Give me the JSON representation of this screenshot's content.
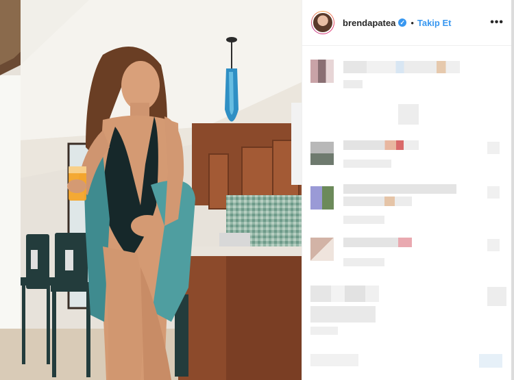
{
  "post": {
    "username": "brendapatea",
    "verified_badge": "✓",
    "separator": "•",
    "follow_label": "Takip Et",
    "more_icon": "more-horizontal-icon"
  },
  "colors": {
    "follow_blue": "#3897f0",
    "username": "#262626",
    "border": "#efefef"
  }
}
